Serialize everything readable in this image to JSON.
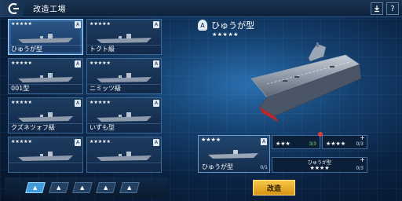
{
  "header": {
    "title": "改造工場",
    "icons": [
      "back-arrow-icon",
      "download-icon",
      "help-icon"
    ],
    "help_label": "?"
  },
  "ship_list": [
    {
      "name": "ひゅうが型",
      "stars": "★★★★★",
      "selected": true,
      "badge": "A"
    },
    {
      "name": "トクト級",
      "stars": "★★★★★",
      "selected": false,
      "badge": "A"
    },
    {
      "name": "001型",
      "stars": "★★★★★",
      "selected": false,
      "badge": "A"
    },
    {
      "name": "ニミッツ級",
      "stars": "★★★★★",
      "selected": false,
      "badge": "A"
    },
    {
      "name": "クズネツォフ級",
      "stars": "★★★★★",
      "selected": false,
      "badge": "A"
    },
    {
      "name": "いずも型",
      "stars": "★★★★★",
      "selected": false,
      "badge": "A"
    },
    {
      "name": "",
      "stars": "★★★★★",
      "selected": false,
      "badge": "A"
    },
    {
      "name": "",
      "stars": "★★★★★",
      "selected": false,
      "badge": "A"
    }
  ],
  "filters": [
    {
      "icon": "carrier-filter-icon",
      "active": true
    },
    {
      "icon": "filter-2-icon",
      "active": false
    },
    {
      "icon": "filter-3-icon",
      "active": false
    },
    {
      "icon": "filter-4-icon",
      "active": false
    },
    {
      "icon": "filter-5-icon",
      "active": false
    }
  ],
  "detail": {
    "badge": "A",
    "title": "ひゅうが型",
    "stars": "★★★★★"
  },
  "base_ship": {
    "stars": "★★★★",
    "name": "ひゅうが型",
    "count": "0/1",
    "badge": "A"
  },
  "materials": {
    "m1": {
      "stars": "★★★",
      "count": "3/3"
    },
    "m2": {
      "stars": "★★★★",
      "count": "0/3"
    },
    "m3": {
      "label": "ひゅうが型",
      "stars": "★★★★",
      "count": "0/3"
    }
  },
  "action": {
    "modify_label": "改造"
  },
  "colors": {
    "accent": "#f5c84a",
    "panel_border": "#6c9ccb",
    "count_ok": "#7de37d",
    "alert": "#e53a3a"
  }
}
